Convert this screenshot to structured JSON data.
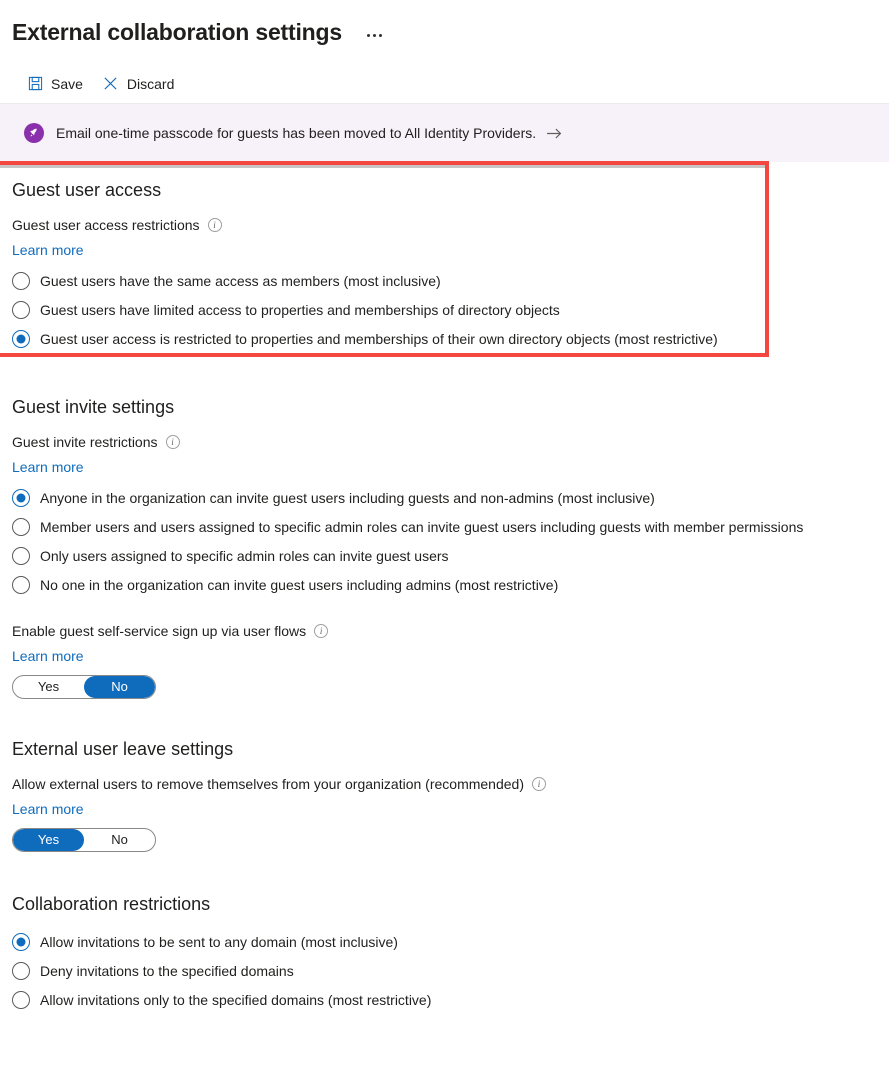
{
  "header": {
    "title": "External collaboration settings",
    "more_menu_icon": "ellipsis-icon"
  },
  "command_bar": {
    "items": [
      {
        "label": "Save",
        "icon": "save-icon"
      },
      {
        "label": "Discard",
        "icon": "close-icon"
      }
    ]
  },
  "banner": {
    "icon": "rocket-icon",
    "text": "Email one-time passcode for guests has been moved to All Identity Providers.",
    "arrow_icon": "arrow-right-icon"
  },
  "sections": {
    "guest_user_access": {
      "title": "Guest user access",
      "field_label": "Guest user access restrictions",
      "info_icon": "info-icon",
      "learn_more": "Learn more",
      "options": [
        {
          "label": "Guest users have the same access as members (most inclusive)",
          "checked": false
        },
        {
          "label": "Guest users have limited access to properties and memberships of directory objects",
          "checked": false
        },
        {
          "label": "Guest user access is restricted to properties and memberships of their own directory objects (most restrictive)",
          "checked": true
        }
      ]
    },
    "guest_invite_settings": {
      "title": "Guest invite settings",
      "field_label": "Guest invite restrictions",
      "info_icon": "info-icon",
      "learn_more": "Learn more",
      "options": [
        {
          "label": "Anyone in the organization can invite guest users including guests and non-admins (most inclusive)",
          "checked": true
        },
        {
          "label": "Member users and users assigned to specific admin roles can invite guest users including guests with member permissions",
          "checked": false
        },
        {
          "label": "Only users assigned to specific admin roles can invite guest users",
          "checked": false
        },
        {
          "label": "No one in the organization can invite guest users including admins (most restrictive)",
          "checked": false
        }
      ],
      "self_service": {
        "label": "Enable guest self-service sign up via user flows",
        "info_icon": "info-icon",
        "learn_more": "Learn more",
        "toggle": {
          "yes_label": "Yes",
          "no_label": "No",
          "value": "No"
        }
      }
    },
    "external_user_leave": {
      "title": "External user leave settings",
      "field_label": "Allow external users to remove themselves from your organization (recommended)",
      "info_icon": "info-icon",
      "learn_more": "Learn more",
      "toggle": {
        "yes_label": "Yes",
        "no_label": "No",
        "value": "Yes"
      }
    },
    "collaboration_restrictions": {
      "title": "Collaboration restrictions",
      "options": [
        {
          "label": "Allow invitations to be sent to any domain (most inclusive)",
          "checked": true
        },
        {
          "label": "Deny invitations to the specified domains",
          "checked": false
        },
        {
          "label": "Allow invitations only to the specified domains (most restrictive)",
          "checked": false
        }
      ]
    }
  },
  "colors": {
    "accent": "#0f6cbd",
    "link": "#0f6cbd",
    "highlight_border": "#f4473f",
    "banner_bg": "#f7f2f9",
    "banner_icon_bg": "#8a30ad"
  }
}
